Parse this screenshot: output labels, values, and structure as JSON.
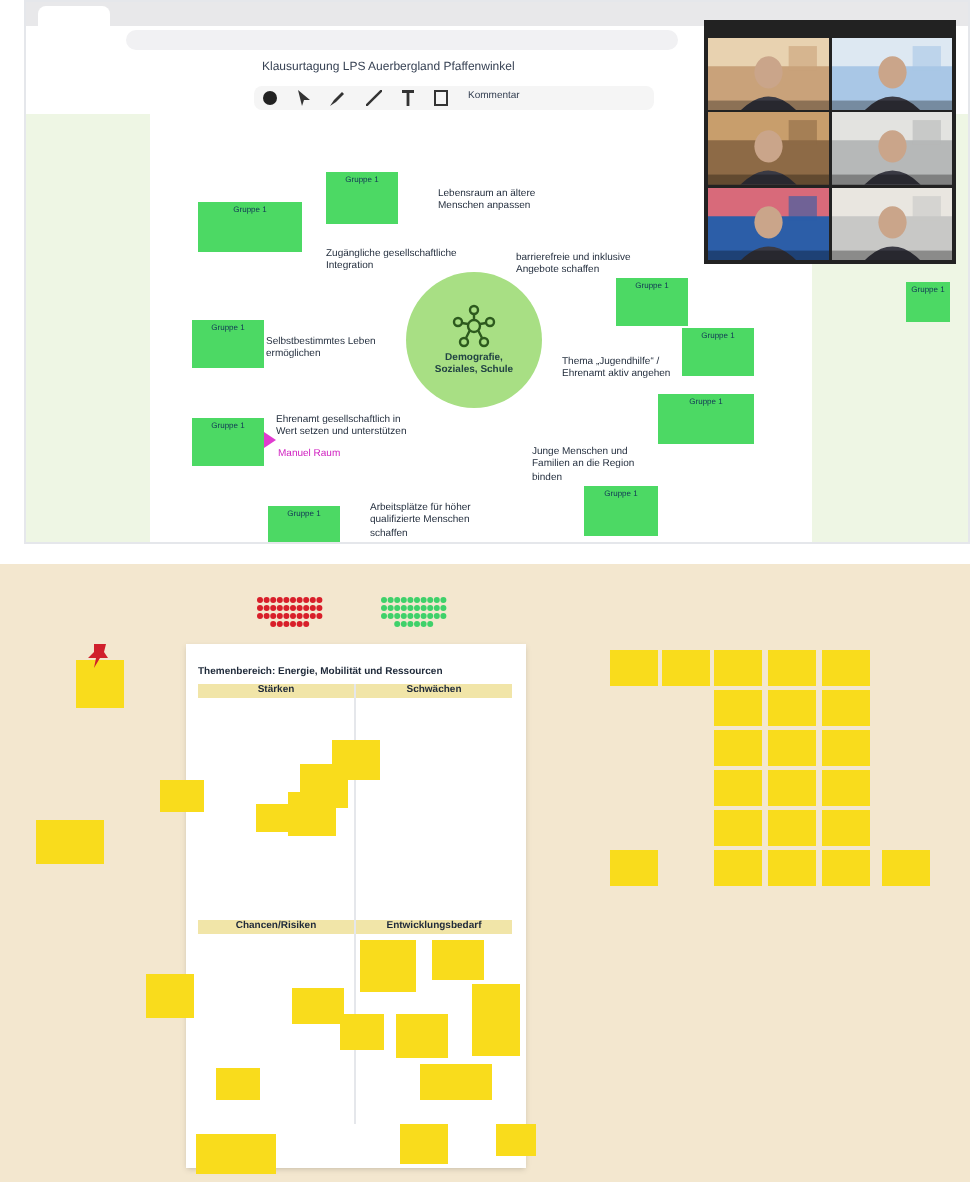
{
  "whiteboard": {
    "board_title": "Klausurtagung LPS Auerbergland Pfaffenwinkel",
    "comment_button": "Kommentar",
    "center_topic": "Demografie, Soziales, Schule",
    "branches": [
      "Lebensraum an ältere Menschen anpassen",
      "Zugängliche gesellschaftliche Integration",
      "barrierefreie und inklusive Angebote schaffen",
      "Selbstbestimmtes Leben ermöglichen",
      "Thema „Jugendhilfe“ / Ehrenamt aktiv angehen",
      "Ehrenamt gesellschaftlich in Wert setzen und unterstützen",
      "Junge Menschen und Familien an die Region binden",
      "Arbeitsplätze für höher qualifizierte Menschen schaffen"
    ],
    "green_notes": [
      "Gruppe 1",
      "Gruppe 1",
      "Gruppe 1",
      "Gruppe 1",
      "Gruppe 1",
      "Gruppe 1",
      "Gruppe 1",
      "Gruppe 1",
      "Gruppe 1",
      "Gruppe 1"
    ],
    "cursor_label": "Manuel Raum"
  },
  "board": {
    "document": {
      "title": "Themenbereich: Energie, Mobilität und Ressourcen",
      "headings": [
        "Stärken",
        "Schwächen",
        "Chancen/Risiken",
        "Entwicklungsbedarf"
      ]
    }
  }
}
